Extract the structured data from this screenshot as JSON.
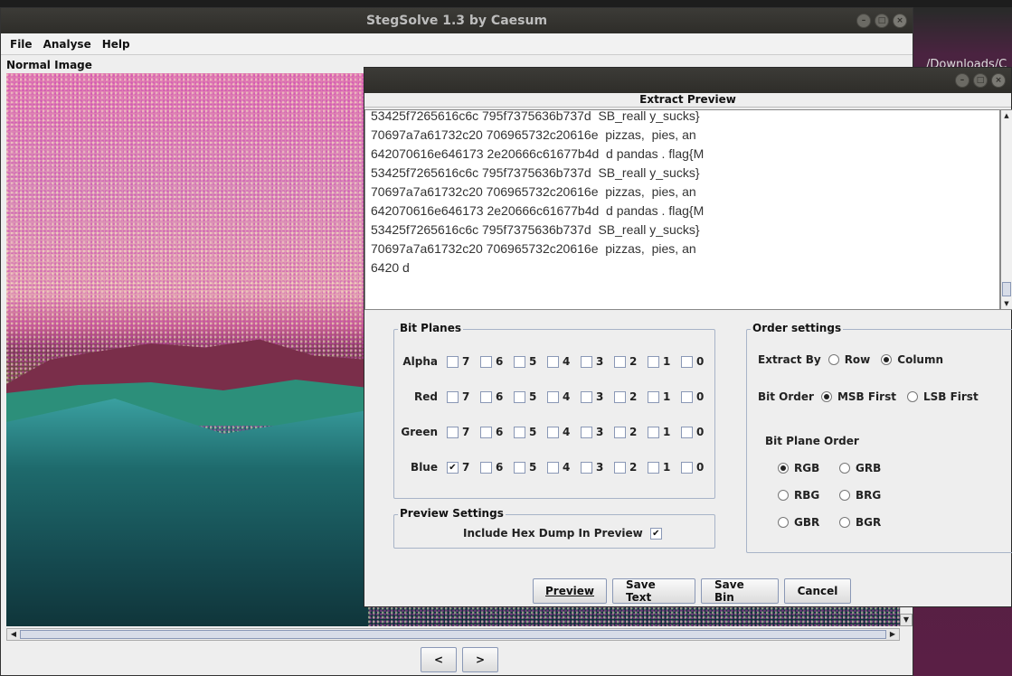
{
  "desktop": {
    "path_fragment": "/Downloads/C"
  },
  "main_window": {
    "title": "StegSolve 1.3 by Caesum",
    "menu": [
      "File",
      "Analyse",
      "Help"
    ],
    "image_label": "Normal Image",
    "nav_prev": "<",
    "nav_next": ">"
  },
  "dialog": {
    "title": "Extract Preview",
    "preview_lines": [
      "53425f7265616c6c 795f7375636b737d  SB_reall y_sucks}",
      "70697a7a61732c20 706965732c20616e  pizzas,  pies, an",
      "642070616e646173 2e20666c61677b4d  d pandas . flag{M",
      "53425f7265616c6c 795f7375636b737d  SB_reall y_sucks}",
      "70697a7a61732c20 706965732c20616e  pizzas,  pies, an",
      "642070616e646173 2e20666c61677b4d  d pandas . flag{M",
      "53425f7265616c6c 795f7375636b737d  SB_reall y_sucks}",
      "70697a7a61732c20 706965732c20616e  pizzas,  pies, an",
      "6420 d"
    ],
    "bit_planes": {
      "title": "Bit Planes",
      "bits": [
        "7",
        "6",
        "5",
        "4",
        "3",
        "2",
        "1",
        "0"
      ],
      "rows": [
        {
          "label": "Alpha",
          "checked": [
            false,
            false,
            false,
            false,
            false,
            false,
            false,
            false
          ]
        },
        {
          "label": "Red",
          "checked": [
            false,
            false,
            false,
            false,
            false,
            false,
            false,
            false
          ]
        },
        {
          "label": "Green",
          "checked": [
            false,
            false,
            false,
            false,
            false,
            false,
            false,
            false
          ]
        },
        {
          "label": "Blue",
          "checked": [
            true,
            false,
            false,
            false,
            false,
            false,
            false,
            false
          ]
        }
      ]
    },
    "preview_settings": {
      "title": "Preview Settings",
      "hex_dump_label": "Include Hex Dump In Preview",
      "hex_dump_checked": true
    },
    "order_settings": {
      "title": "Order settings",
      "extract_by_label": "Extract By",
      "extract_by_options": [
        "Row",
        "Column"
      ],
      "extract_by_selected": "Column",
      "bit_order_label": "Bit Order",
      "bit_order_options": [
        "MSB First",
        "LSB First"
      ],
      "bit_order_selected": "MSB First",
      "bit_plane_order_label": "Bit Plane Order",
      "bit_plane_order_options": [
        "RGB",
        "GRB",
        "RBG",
        "BRG",
        "GBR",
        "BGR"
      ],
      "bit_plane_order_selected": "RGB"
    },
    "buttons": {
      "preview": "Preview",
      "save_text": "Save Text",
      "save_bin": "Save Bin",
      "cancel": "Cancel"
    },
    "check_mark": "✔"
  }
}
